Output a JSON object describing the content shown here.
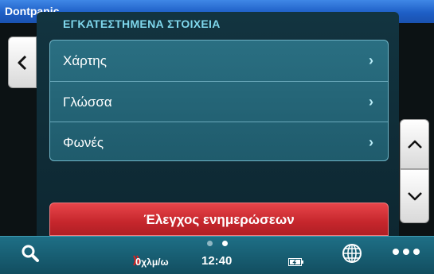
{
  "window": {
    "title": "Dontpanic"
  },
  "settings": {
    "heading": "ΕΓΚΑΤΕΣΤΗΜΕΝΑ ΣΤΟΙΧΕΙΑ",
    "items": [
      {
        "label": "Χάρτης",
        "icon": "chevron-right-icon"
      },
      {
        "label": "Γλώσσα",
        "icon": "chevron-right-icon"
      },
      {
        "label": "Φωνές",
        "icon": "chevron-right-icon"
      }
    ],
    "update_button": "Έλεγχος ενημερώσεων"
  },
  "statusbar": {
    "speed_value": "0",
    "speed_unit": "χλμ/ω",
    "time": "12:40",
    "page_count": 2,
    "active_page": 2
  },
  "colors": {
    "accent_red": "#c5262c",
    "panel": "#1f5b6c",
    "heading": "#7fd7ec",
    "titlebar": "#1e5fc6"
  }
}
